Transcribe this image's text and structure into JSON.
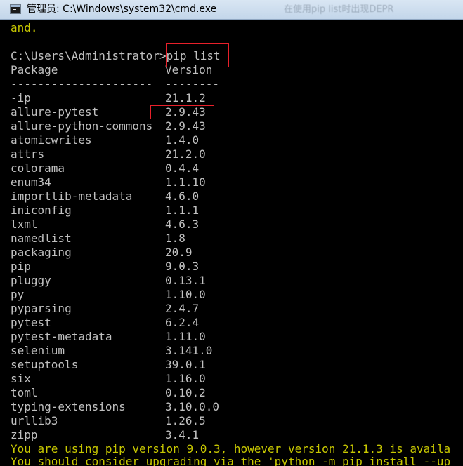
{
  "window": {
    "title": "管理员: C:\\Windows\\system32\\cmd.exe",
    "ghost_title": "在使用pip list时出现DEPR"
  },
  "console": {
    "intro_line": "and.",
    "prompt": "C:\\Users\\Administrator>",
    "command": "pip list",
    "header": {
      "package": "Package",
      "version": "Version"
    },
    "separator": {
      "package": "---------------------",
      "version": "--------"
    },
    "packages": [
      {
        "name": "-ip",
        "version": "21.1.2"
      },
      {
        "name": "allure-pytest",
        "version": "2.9.43"
      },
      {
        "name": "allure-python-commons",
        "version": "2.9.43"
      },
      {
        "name": "atomicwrites",
        "version": "1.4.0"
      },
      {
        "name": "attrs",
        "version": "21.2.0"
      },
      {
        "name": "colorama",
        "version": "0.4.4"
      },
      {
        "name": "enum34",
        "version": "1.1.10"
      },
      {
        "name": "importlib-metadata",
        "version": "4.6.0"
      },
      {
        "name": "iniconfig",
        "version": "1.1.1"
      },
      {
        "name": "lxml",
        "version": "4.6.3"
      },
      {
        "name": "namedlist",
        "version": "1.8"
      },
      {
        "name": "packaging",
        "version": "20.9"
      },
      {
        "name": "pip",
        "version": "9.0.3"
      },
      {
        "name": "pluggy",
        "version": "0.13.1"
      },
      {
        "name": "py",
        "version": "1.10.0"
      },
      {
        "name": "pyparsing",
        "version": "2.4.7"
      },
      {
        "name": "pytest",
        "version": "6.2.4"
      },
      {
        "name": "pytest-metadata",
        "version": "1.11.0"
      },
      {
        "name": "selenium",
        "version": "3.141.0"
      },
      {
        "name": "setuptools",
        "version": "39.0.1"
      },
      {
        "name": "six",
        "version": "1.16.0"
      },
      {
        "name": "toml",
        "version": "0.10.2"
      },
      {
        "name": "typing-extensions",
        "version": "3.10.0.0"
      },
      {
        "name": "urllib3",
        "version": "1.26.5"
      },
      {
        "name": "zipp",
        "version": "3.4.1"
      }
    ],
    "warning_line_1": "You are using pip version 9.0.3, however version 21.1.3 is availa",
    "warning_line_2": "You should consider upgrading via the 'python -m pip install --up"
  },
  "colors": {
    "console_text": "#c0c0c0",
    "warning_text": "#c8c800",
    "highlight_box": "#e8202a",
    "background": "#000000"
  },
  "icons": {
    "window_icon": "cmd-icon"
  }
}
